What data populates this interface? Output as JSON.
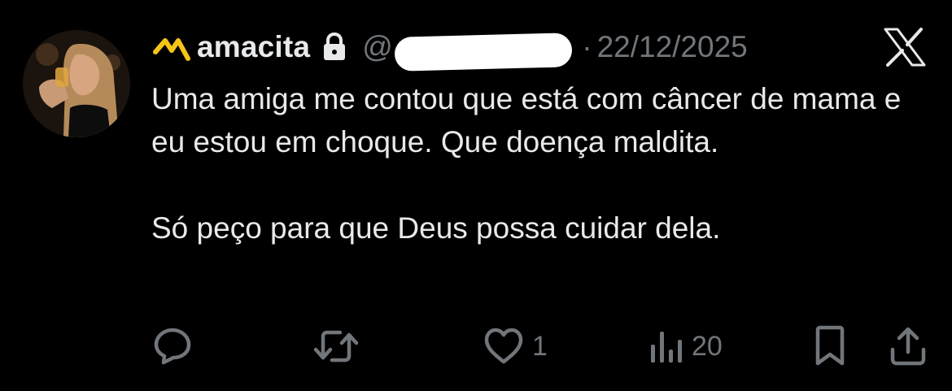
{
  "user": {
    "display_name": "amacita",
    "handle": "@",
    "date": "22/12/2025",
    "separator": "·",
    "badge_icon": "crown-badge-icon",
    "lock_icon": "lock-icon",
    "badge_color": "#f5c518"
  },
  "tweet": {
    "paragraph_1": "Uma amiga me contou que está com câncer de mama e eu estou em choque. Que doença maldita.",
    "paragraph_2": "Só peço para que Deus possa cuidar dela."
  },
  "actions": {
    "reply_icon": "reply-icon",
    "retweet_icon": "retweet-icon",
    "like_icon": "heart-icon",
    "like_count": "1",
    "views_icon": "views-icon",
    "views_count": "20",
    "bookmark_icon": "bookmark-icon",
    "share_icon": "share-icon"
  },
  "brand": {
    "logo": "x-logo-icon"
  },
  "colors": {
    "background": "#000000",
    "text": "#e7e9ea",
    "muted": "#71767b"
  }
}
